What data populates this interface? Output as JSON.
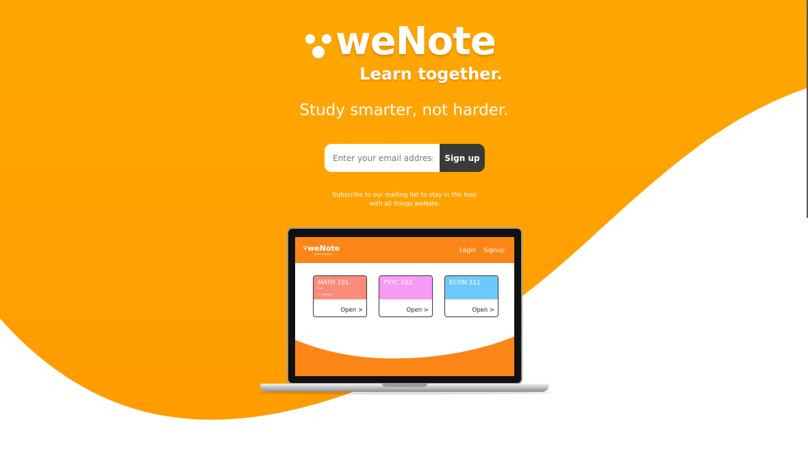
{
  "colors": {
    "brand_orange": "#ffa300",
    "brand_orange_deep": "#fb8617",
    "button_dark": "#3a3a3a",
    "card_math": "#fa8b78",
    "card_psyc": "#f79af5",
    "card_econ": "#6ec9fb"
  },
  "brand": {
    "name": "weNote",
    "tagline": "Learn together."
  },
  "hero": {
    "headline": "Study smarter, not harder."
  },
  "signup": {
    "email_placeholder": "Enter your email address",
    "button_label": "Sign up",
    "note": "Subscribe to our mailing list to stay in the loop with all things weNote."
  },
  "preview": {
    "logo_name": "weNote",
    "logo_tagline": "Learn together.",
    "nav": {
      "login": "Login",
      "signup": "Signup"
    },
    "courses": [
      {
        "title": "MATH 101",
        "subtitle": "Calc",
        "count": "82 students",
        "open_label": "Open >",
        "color": "#fa8b78"
      },
      {
        "title": "PSYC 102",
        "subtitle": "",
        "count": "",
        "open_label": "Open >",
        "color": "#f79af5"
      },
      {
        "title": "ECON 311",
        "subtitle": "",
        "count": "",
        "open_label": "Open >",
        "color": "#6ec9fb"
      }
    ]
  }
}
